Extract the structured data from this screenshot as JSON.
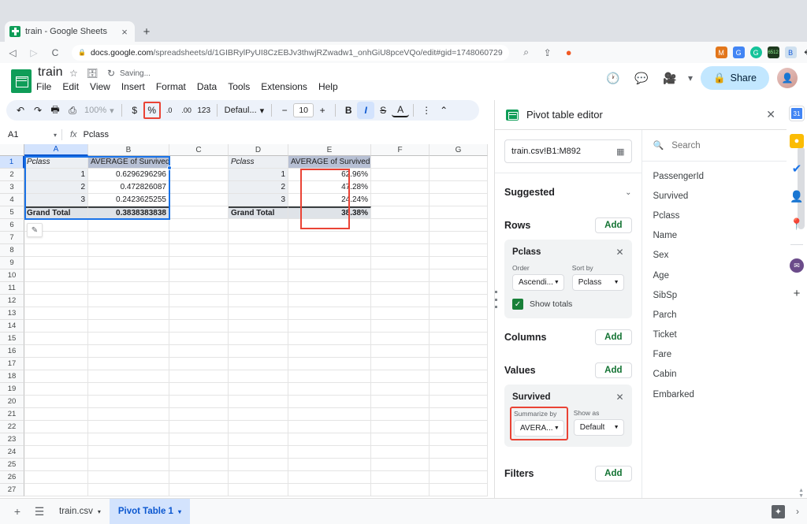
{
  "browser": {
    "tab": {
      "title": "train - Google Sheets",
      "favicon": "sheets-icon",
      "close": "×"
    },
    "new_tab": "+",
    "nav": {
      "back": "◁",
      "forward": "▷",
      "reload": "C"
    },
    "omnibox": {
      "lock": "🔒",
      "url_domain": "docs.google.com",
      "url_path": "/spreadsheets/d/1GIBRylPyUI8CzEBJv3thwjRZwadw1_onhGiU8pceVQo/edit#gid=1748060729",
      "zoom_icon": "⌕",
      "share_icon": "⇪",
      "brave_icon": "shield-icon"
    },
    "extensions": [
      "metamask-icon",
      "google-translate-icon",
      "grammarly-icon",
      "screen-capture-icon",
      "bitwarden-icon",
      "puzzle-icon",
      "reading-list-icon",
      "menu-icon"
    ]
  },
  "sheets": {
    "logo": "sheets-logo",
    "doc_title": "train",
    "title_icons": [
      "star-icon",
      "move-folder-icon",
      "history-icon"
    ],
    "saving_status": "Saving...",
    "menus": [
      "File",
      "Edit",
      "View",
      "Insert",
      "Format",
      "Data",
      "Tools",
      "Extensions",
      "Help"
    ],
    "header_actions": {
      "history_icon": "clock-history-icon",
      "comment_icon": "comment-icon",
      "meet_icon": "video-camera-icon",
      "meet_caret": "▾",
      "share_label": "Share",
      "share_lock": "🔒",
      "avatar": "user-avatar"
    }
  },
  "toolbar": {
    "undo": "↶",
    "redo": "↷",
    "print": "🖶",
    "paint_format": "paint-roller",
    "zoom_value": "100%",
    "zoom_caret": "▾",
    "currency": "$",
    "percent": "%",
    "decrease_decimal": ".0",
    "increase_decimal": ".00",
    "more_formats": "123",
    "font": "Defaul...",
    "font_caret": "▾",
    "size_minus": "−",
    "font_size": "10",
    "size_plus": "+",
    "bold": "B",
    "italic": "I",
    "strikethrough": "S",
    "text_color": "A",
    "more": "⋮",
    "collapse": "⌃"
  },
  "formula_bar": {
    "name_box": "A1",
    "name_caret": "▾",
    "fx": "fx",
    "value": "Pclass"
  },
  "grid": {
    "columns": [
      "A",
      "B",
      "C",
      "D",
      "E",
      "F",
      "G"
    ],
    "selected_column": "A",
    "selected_row": "1",
    "rows": [
      "1",
      "2",
      "3",
      "4",
      "5",
      "6",
      "7",
      "8",
      "9",
      "10",
      "11",
      "12",
      "13",
      "14",
      "15",
      "16",
      "17",
      "18",
      "19",
      "20",
      "21",
      "22",
      "23",
      "24",
      "25",
      "26",
      "27"
    ],
    "pencil_badge": "✎",
    "pivot_left": {
      "header": {
        "label": "Pclass",
        "value_header": "AVERAGE of Survived"
      },
      "data": [
        {
          "pclass": "1",
          "value": "0.6296296296"
        },
        {
          "pclass": "2",
          "value": "0.472826087"
        },
        {
          "pclass": "3",
          "value": "0.2423625255"
        }
      ],
      "total": {
        "label": "Grand Total",
        "value": "0.3838383838"
      }
    },
    "pivot_right": {
      "header": {
        "label": "Pclass",
        "value_header": "AVERAGE of Survived"
      },
      "data": [
        {
          "pclass": "1",
          "value": "62.96%"
        },
        {
          "pclass": "2",
          "value": "47.28%"
        },
        {
          "pclass": "3",
          "value": "24.24%"
        }
      ],
      "total": {
        "label": "Grand Total",
        "value": "38.38%"
      }
    }
  },
  "pivot_panel": {
    "icon": "pivot-table-icon",
    "title": "Pivot table editor",
    "close": "✕",
    "data_range": "train.csv!B1:M892",
    "range_icon": "grid-select-icon",
    "suggested_label": "Suggested",
    "suggested_caret": "⌄",
    "rows": {
      "label": "Rows",
      "add": "Add",
      "field": {
        "name": "Pclass",
        "remove": "✕",
        "order_label": "Order",
        "order_value": "Ascendi...",
        "sortby_label": "Sort by",
        "sortby_value": "Pclass",
        "show_totals_label": "Show totals",
        "show_totals_checked": true,
        "check_glyph": "✓"
      }
    },
    "columns": {
      "label": "Columns",
      "add": "Add"
    },
    "values": {
      "label": "Values",
      "add": "Add",
      "field": {
        "name": "Survived",
        "remove": "✕",
        "summarize_label": "Summarize by",
        "summarize_value": "AVERA...",
        "showas_label": "Show as",
        "showas_value": "Default"
      }
    },
    "filters": {
      "label": "Filters",
      "add": "Add"
    },
    "search": {
      "icon": "search-icon",
      "placeholder": "Search"
    },
    "field_list": [
      "PassengerId",
      "Survived",
      "Pclass",
      "Name",
      "Sex",
      "Age",
      "SibSp",
      "Parch",
      "Ticket",
      "Fare",
      "Cabin",
      "Embarked"
    ]
  },
  "side_rail": {
    "icons": [
      "calendar-icon",
      "keep-icon",
      "tasks-icon",
      "contacts-icon",
      "maps-icon"
    ],
    "addon_icon": "addon-icon",
    "add_icon": "+"
  },
  "bottom": {
    "add_sheet": "+",
    "all_sheets": "☰",
    "tabs": [
      {
        "name": "train.csv",
        "active": false,
        "caret": "▾"
      },
      {
        "name": "Pivot Table 1",
        "active": true,
        "caret": "▾"
      }
    ],
    "explore": "✦",
    "expand": "›"
  },
  "colors": {
    "sheets_green": "#0f9d58",
    "accent_blue": "#1a73e8",
    "highlight_red": "#ea4335",
    "selected_tab_bg": "#d3e3fd",
    "pivot_header_bg": "#b7c0d4"
  }
}
